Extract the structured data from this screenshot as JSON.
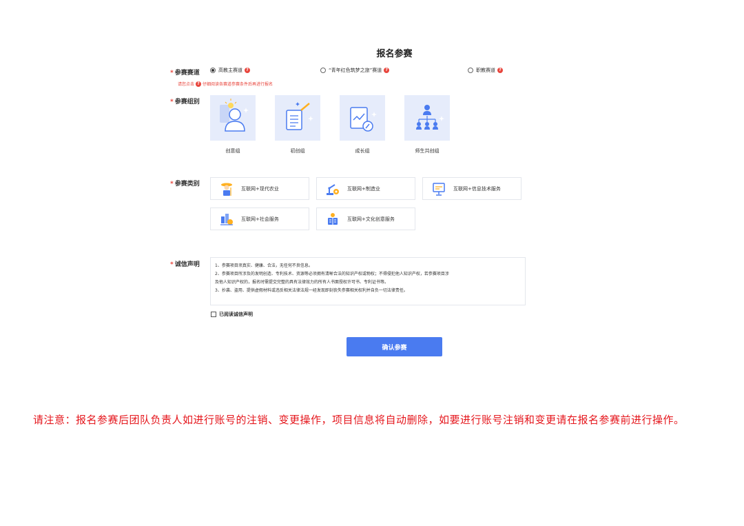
{
  "page_title": "报名参赛",
  "track": {
    "label": "参赛赛道",
    "options": [
      {
        "label": "高教主赛道",
        "selected": true
      },
      {
        "label": "“青年红色筑梦之旅”赛道",
        "selected": false
      },
      {
        "label": "职教赛道",
        "selected": false
      }
    ],
    "hint_before": "请您点击",
    "hint_after": "仔细阅读各赛道参赛条件后再进行报名",
    "help_icon": "question-circle-icon"
  },
  "group": {
    "label": "参赛组别",
    "options": [
      {
        "label": "创意组",
        "icon": "idea-person-icon"
      },
      {
        "label": "初创组",
        "icon": "document-wand-icon"
      },
      {
        "label": "成长组",
        "icon": "chart-growth-icon"
      },
      {
        "label": "师生共创组",
        "icon": "team-org-icon"
      }
    ]
  },
  "category": {
    "label": "参赛类别",
    "options": [
      {
        "label": "互联网+现代农业",
        "icon": "farmer-icon"
      },
      {
        "label": "互联网+制造业",
        "icon": "robot-arm-icon"
      },
      {
        "label": "互联网+信息技术服务",
        "icon": "monitor-icon"
      },
      {
        "label": "互联网+社会服务",
        "icon": "city-service-icon"
      },
      {
        "label": "互联网+文化创意服务",
        "icon": "culture-book-icon"
      }
    ]
  },
  "declaration": {
    "label": "诚信声明",
    "lines": [
      "1、参赛项目须真实、健康、合法，无任何不良信息。",
      "2、参赛项目所涉及的发明创造、专利技术、资源等必须拥有清晰合法的知识产权或物权；不得侵犯他人知识产权，若参赛项目涉",
      "及他人知识产权的，报名时需提交完整的具有法律效力的所有人书面授权许可书、专利证书等。",
      "3、抄袭、盗用、提供虚假材料或违反相关法律法规一经发现即刻丧失参赛相关权利并自负一切法律责任。"
    ],
    "checkbox_label": "已阅读诚信声明",
    "checked": false
  },
  "confirm_button": "确认参赛",
  "notice": "请注意：报名参赛后团队负责人如进行账号的注销、变更操作，项目信息将自动删除，如要进行账号注销和变更请在报名参赛前进行操作。",
  "colors": {
    "accent": "#4a7bf0",
    "required": "#e8453c",
    "notice": "#e5161c",
    "card_bg": "#e6ecfb"
  }
}
